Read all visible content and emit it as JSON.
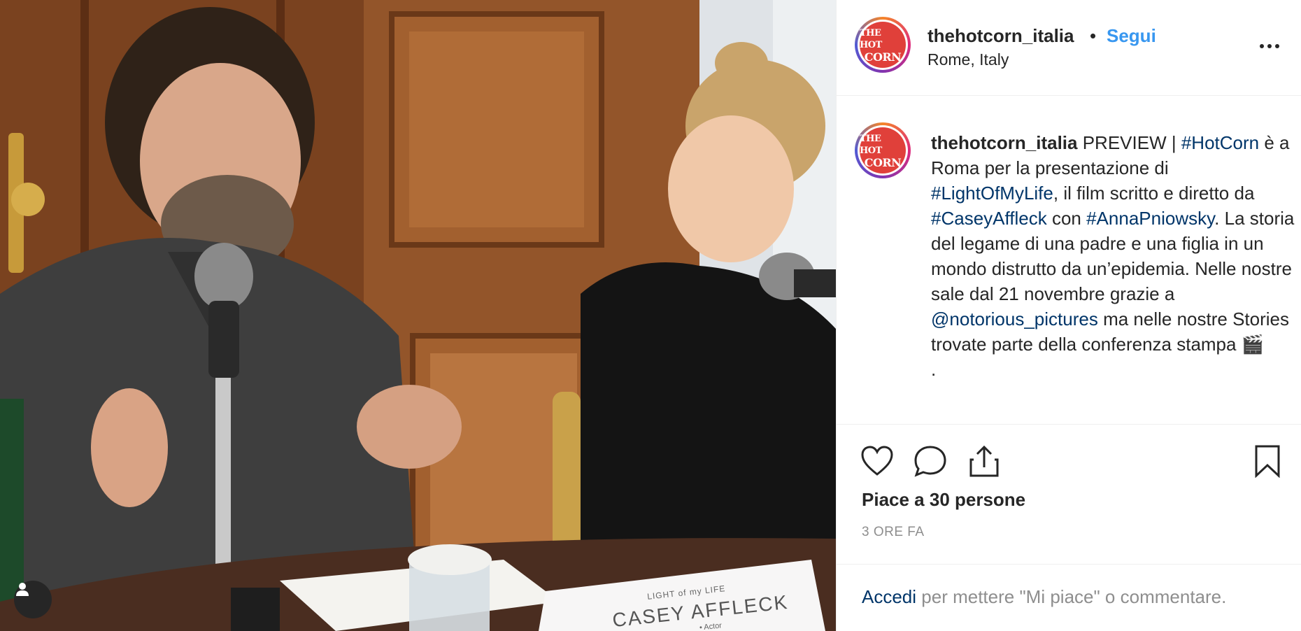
{
  "post": {
    "author": "thehotcorn_italia",
    "separator": "•",
    "follow_label": "Segui",
    "location": "Rome, Italy",
    "avatar_logo_lines": [
      "THE HOT",
      "CORN"
    ],
    "caption": {
      "username": "thehotcorn_italia",
      "text_1": " PREVIEW | ",
      "hashtag_1": "#HotCorn",
      "text_2": " è a Roma per la presentazione di ",
      "hashtag_2": "#LightOfMyLife",
      "text_3": ", il film scritto e diretto da ",
      "hashtag_3": "#CaseyAffleck",
      "text_4": " con ",
      "hashtag_4": "#AnnaPniowsky",
      "text_5": ". La storia del legame di una padre e una figlia in un mondo distrutto da un’epidemia. Nelle nostre sale dal 21 novembre grazie a ",
      "mention": "@notorious_pictures",
      "text_6": " ma nelle nostre Stories trovate parte della conferenza stampa 🎬",
      "text_7": "."
    },
    "likes": "Piace a 30 persone",
    "timestamp": "3 ORE FA",
    "login_link": "Accedi",
    "login_text": " per mettere \"Mi piace\" o commentare."
  },
  "photo": {
    "nameplate_subtitle": "LIGHT of my LIFE",
    "nameplate_name": "CASEY AFFLECK",
    "nameplate_role": "• Actor"
  },
  "icons": [
    "heart-icon",
    "comment-icon",
    "share-icon",
    "bookmark-icon",
    "more-options-icon",
    "user-tag-icon"
  ],
  "colors": {
    "follow_blue": "#3897f0",
    "link_navy": "#003569",
    "muted_gray": "#8e8e8e",
    "text": "#262626"
  }
}
